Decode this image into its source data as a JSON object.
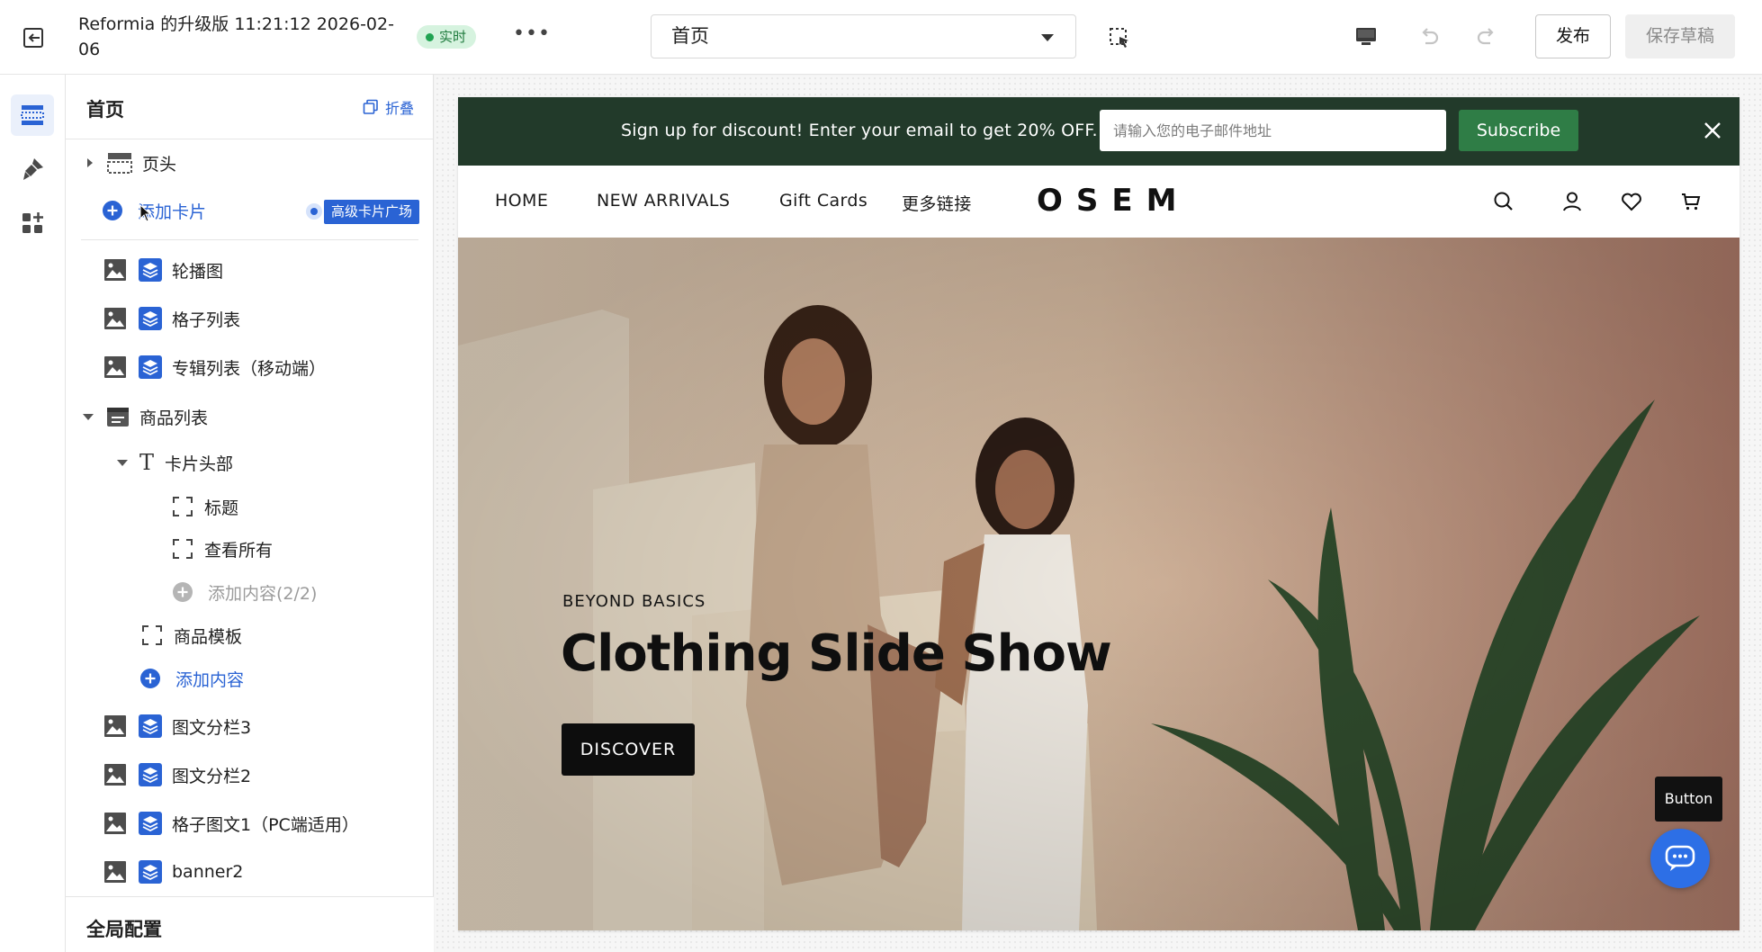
{
  "topbar": {
    "doc_title": "Reformia 的升级版 11:21:12 2026-02-06",
    "live_label": "实时",
    "page_select_value": "首页",
    "publish_label": "发布",
    "save_draft_label": "保存草稿",
    "icons": [
      "exit-icon",
      "more-icon",
      "select-tool-icon",
      "desktop-icon",
      "undo-icon",
      "redo-icon"
    ]
  },
  "rail": {
    "items": [
      {
        "icon": "sections-icon",
        "active": true
      },
      {
        "icon": "theme-brush-icon",
        "active": false
      },
      {
        "icon": "apps-icon",
        "active": false
      }
    ]
  },
  "sidebar": {
    "title": "首页",
    "collapse_label": "折叠",
    "header_row": {
      "label": "页头"
    },
    "add_card": {
      "label": "添加卡片",
      "badge": "高级卡片广场"
    },
    "tree": [
      {
        "label": "轮播图"
      },
      {
        "label": "格子列表"
      },
      {
        "label": "专辑列表（移动端）"
      },
      {
        "label": "商品列表"
      },
      {
        "label": "卡片头部"
      },
      {
        "label": "标题"
      },
      {
        "label": "查看所有"
      },
      {
        "label": "添加内容(2/2)"
      },
      {
        "label": "商品模板"
      },
      {
        "label": "添加内容"
      },
      {
        "label": "图文分栏3"
      },
      {
        "label": "图文分栏2"
      },
      {
        "label": "格子图文1（PC端适用）"
      },
      {
        "label": "banner2"
      }
    ],
    "global_config_label": "全局配置"
  },
  "preview": {
    "announcement": {
      "text": "Sign up for discount! Enter your email to get 20% OFF.",
      "email_placeholder": "请输入您的电子邮件地址",
      "subscribe_label": "Subscribe"
    },
    "nav": {
      "links": [
        "HOME",
        "NEW ARRIVALS",
        "Gift Cards",
        "更多链接"
      ],
      "logo": "OSEM",
      "icons": [
        "search-icon",
        "account-icon",
        "wishlist-icon",
        "cart-icon"
      ]
    },
    "hero": {
      "eyebrow": "BEYOND BASICS",
      "title": "Clothing Slide Show",
      "cta_label": "DISCOVER"
    },
    "floating": {
      "tooltip_label": "Button",
      "chat_icon": "chat-icon"
    }
  },
  "colors": {
    "accent_blue": "#2a63d4",
    "announcement_bg": "#223a2a",
    "subscribe_bg": "#2f7d46",
    "live_badge_bg": "#d6f3df",
    "chat_fab_bg": "#2d6fe6"
  }
}
